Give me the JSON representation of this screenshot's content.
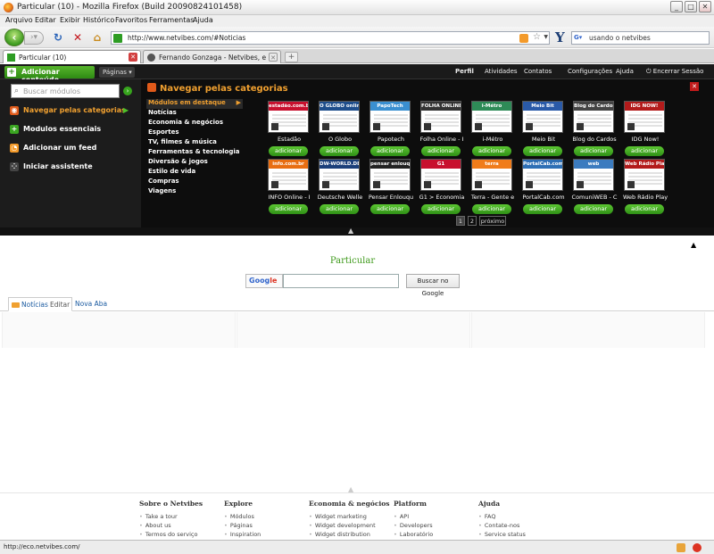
{
  "window": {
    "title": "Particular (10) - Mozilla Firefox (Build 20090824101458)",
    "minimize": "_",
    "maximize": "□",
    "close": "✕"
  },
  "menu": [
    "Arquivo",
    "Editar",
    "Exibir",
    "Histórico",
    "Favoritos",
    "Ferramentas",
    "Ajuda"
  ],
  "nav": {
    "url": "http://www.netvibes.com/#Noticias",
    "search_text": "usando o netvibes"
  },
  "tabs": [
    {
      "label": "Particular (10)"
    },
    {
      "label": "Fernando Gonzaga - Netvibes, excelen..."
    }
  ],
  "netvibes": {
    "add_content": "Adicionar conteúdo",
    "pages": "Páginas",
    "top_links": [
      "Perfil",
      "Atividades",
      "Contatos",
      "Configurações",
      "Ajuda",
      "Encerrar Sessão"
    ],
    "search_placeholder": "Buscar módulos",
    "left_items": [
      "Navegar pelas categorias",
      "Modulos essenciais",
      "Adicionar um feed",
      "Iniciar assistente"
    ],
    "panel_title": "Navegar pelas categorias",
    "categories": [
      "Módulos em destaque",
      "Notícias",
      "Economia & negócios",
      "Esportes",
      "TV, filmes & música",
      "Ferramentas & tecnologia",
      "Diversão & jogos",
      "Estilo de vida",
      "Compras",
      "Viagens"
    ],
    "modules": [
      {
        "name": "Estadão",
        "thumb": "estadão.com.br",
        "color": "#c8102e"
      },
      {
        "name": "O Globo",
        "thumb": "O GLOBO online",
        "color": "#1f4e8c"
      },
      {
        "name": "Papotech",
        "thumb": "PapoTech",
        "color": "#3a8fd0"
      },
      {
        "name": "Folha Online - I",
        "thumb": "FOLHA ONLINE",
        "color": "#333333"
      },
      {
        "name": "i-Métro",
        "thumb": "i-Métro",
        "color": "#2e8b57"
      },
      {
        "name": "Meio Bit",
        "thumb": "Meio Bit",
        "color": "#2a5aa8"
      },
      {
        "name": "Blog do Cardos",
        "thumb": "Blog do Cardoso",
        "color": "#444444"
      },
      {
        "name": "IDG Now!",
        "thumb": "IDG NOW!",
        "color": "#b31b1b"
      },
      {
        "name": "INFO Online - I",
        "thumb": "info.com.br",
        "color": "#e86e12"
      },
      {
        "name": "Deutsche Welle",
        "thumb": "DW-WORLD.DE",
        "color": "#1b3f7a"
      },
      {
        "name": "Pensar Enlouqu",
        "thumb": "pensar enlouquece",
        "color": "#222222"
      },
      {
        "name": "G1 > Economia",
        "thumb": "G1",
        "color": "#c8102e"
      },
      {
        "name": "Terra - Gente e",
        "thumb": "terra",
        "color": "#f07c1a"
      },
      {
        "name": "PortalCab.com",
        "thumb": "PortalCab.com",
        "color": "#2d6fb5"
      },
      {
        "name": "ComuniWEB - C",
        "thumb": "web",
        "color": "#3b7bbf"
      },
      {
        "name": "Web Rádio Play",
        "thumb": "Web Rádio Player",
        "color": "#b31b1b"
      }
    ],
    "add_label": "adicionar",
    "pager": [
      "1",
      "2",
      "próximo"
    ]
  },
  "page": {
    "title": "Particular",
    "google_logo_a": "Goog",
    "google_logo_b": "le",
    "search_button": "Buscar no Google",
    "tab_noticias": "Notícias",
    "tab_edit": "Editar",
    "tab_new": "Nova Aba"
  },
  "footer": [
    {
      "heading": "Sobre o Netvibes",
      "items": [
        "Take a tour",
        "About us",
        "Termos do serviço"
      ]
    },
    {
      "heading": "Explore",
      "items": [
        "Módulos",
        "Páginas",
        "Inspiration"
      ]
    },
    {
      "heading": "Economia & negócios",
      "items": [
        "Widget marketing",
        "Widget development",
        "Widget distribution"
      ]
    },
    {
      "heading": "Platform",
      "items": [
        "API",
        "Developers",
        "Laboratório"
      ]
    },
    {
      "heading": "Ajuda",
      "items": [
        "FAQ",
        "Contate-nos",
        "Service status"
      ]
    }
  ],
  "status": "http://eco.netvibes.com/"
}
